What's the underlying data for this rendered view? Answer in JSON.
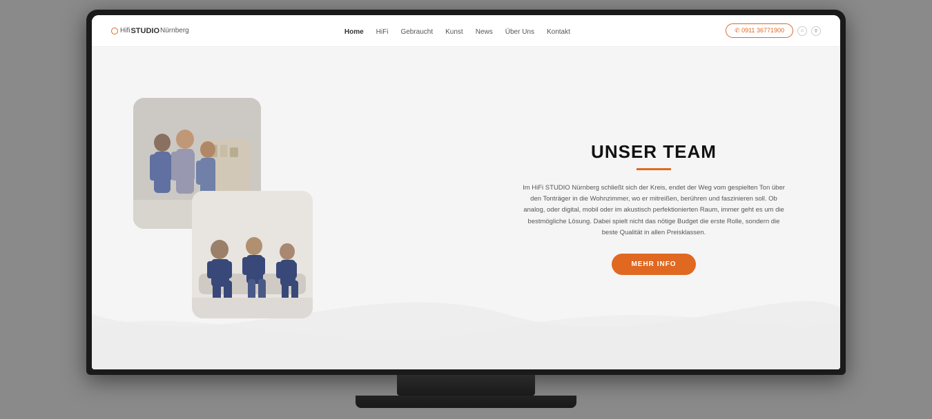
{
  "monitor": {
    "label": "Monitor displaying Hifi Studio Nürnberg website"
  },
  "navbar": {
    "logo": {
      "hifi": "Hifi",
      "studio": "STUDIO",
      "city": "Nürnberg"
    },
    "nav_items": [
      {
        "label": "Home",
        "active": true
      },
      {
        "label": "HiFi",
        "active": false
      },
      {
        "label": "Gebraucht",
        "active": false
      },
      {
        "label": "Kunst",
        "active": false
      },
      {
        "label": "News",
        "active": false
      },
      {
        "label": "Über Uns",
        "active": false
      },
      {
        "label": "Kontakt",
        "active": false
      }
    ],
    "phone": "✆ 0911 36771900",
    "icons": {
      "home": "⌂",
      "location": "⚲"
    }
  },
  "team_section": {
    "title": "UNSER TEAM",
    "description": "Im HiFi STUDIO Nürnberg schließt sich der Kreis, endet der Weg vom gespielten Ton über den Tonträger in die Wohnzimmer, wo er mitreißen, berühren und faszinieren soll.  Ob analog, oder digital, mobil oder im akustisch perfektionierten Raum, immer geht es um die bestmögliche Lösung. Dabei spielt nicht das nötige Budget die erste Rolle, sondern die beste Qualität in allen Preisklassen.",
    "button_label": "MEHR INFO"
  },
  "colors": {
    "orange": "#e06820",
    "dark": "#111111",
    "mid_gray": "#555555",
    "light_bg": "#f5f5f5"
  }
}
